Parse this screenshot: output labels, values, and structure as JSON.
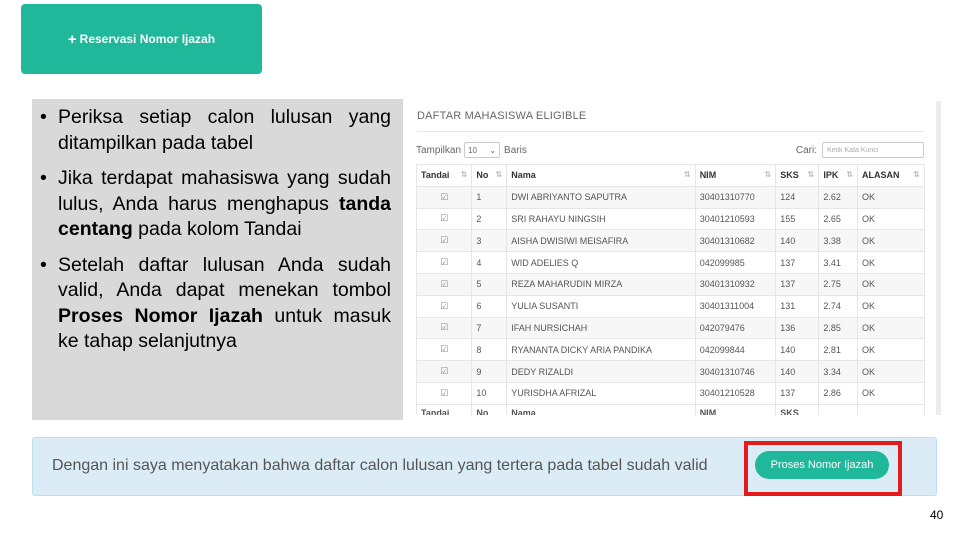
{
  "reserve_button": {
    "icon": "plus-icon",
    "label": "Reservasi Nomor Ijazah"
  },
  "notes": [
    {
      "parts": [
        {
          "text": "Periksa setiap calon lulusan yang ditampilkan pada tabel",
          "bold": false
        }
      ]
    },
    {
      "parts": [
        {
          "text": "Jika terdapat mahasiswa yang sudah lulus, Anda harus menghapus ",
          "bold": false
        },
        {
          "text": "tanda centang",
          "bold": true
        },
        {
          "text": " pada kolom Tandai",
          "bold": false
        }
      ]
    },
    {
      "parts": [
        {
          "text": "Setelah daftar lulusan Anda sudah valid, Anda dapat menekan tombol ",
          "bold": false
        },
        {
          "text": "Proses Nomor Ijazah",
          "bold": true
        },
        {
          "text": " untuk masuk ke tahap selanjutnya",
          "bold": false
        }
      ]
    }
  ],
  "panel": {
    "title": "DAFTAR MAHASISWA ELIGIBLE",
    "show_label": "Tampilkan",
    "page_size": "10",
    "rows_label": "Baris",
    "search_label": "Cari:",
    "search_placeholder": "Ketik Kata Kunci"
  },
  "table": {
    "headers": [
      "Tandai",
      "No",
      "Nama",
      "NIM",
      "SKS",
      "IPK",
      "ALASAN"
    ],
    "footer_headers": [
      "Tandai",
      "No",
      "Nama",
      "NIM",
      "SKS",
      "",
      ""
    ],
    "rows": [
      [
        "☑",
        "1",
        "DWI ABRIYANTO SAPUTRA",
        "30401310770",
        "124",
        "2.62",
        "OK"
      ],
      [
        "☑",
        "2",
        "SRI RAHAYU NINGSIH",
        "30401210593",
        "155",
        "2.65",
        "OK"
      ],
      [
        "☑",
        "3",
        "AISHA DWISIWI MEISAFIRA",
        "30401310682",
        "140",
        "3.38",
        "OK"
      ],
      [
        "☑",
        "4",
        "WID ADELIES Q",
        "042099985",
        "137",
        "3.41",
        "OK"
      ],
      [
        "☑",
        "5",
        "REZA MAHARUDIN MIRZA",
        "30401310932",
        "137",
        "2.75",
        "OK"
      ],
      [
        "☑",
        "6",
        "YULIA SUSANTI",
        "30401311004",
        "131",
        "2.74",
        "OK"
      ],
      [
        "☑",
        "7",
        "IFAH NURSICHAH",
        "042079476",
        "136",
        "2.85",
        "OK"
      ],
      [
        "☑",
        "8",
        "RYANANTA DICKY ARIA PANDIKA",
        "042099844",
        "140",
        "2.81",
        "OK"
      ],
      [
        "☑",
        "9",
        "DEDY RIZALDI",
        "30401310746",
        "140",
        "3.34",
        "OK"
      ],
      [
        "☑",
        "10",
        "YURISDHA AFRIZAL",
        "30401210528",
        "137",
        "2.86",
        "OK"
      ]
    ]
  },
  "confirm": {
    "text": "Dengan ini saya menyatakan bahwa daftar calon lulusan yang tertera pada tabel sudah valid",
    "button_label": "Proses Nomor Ijazah",
    "highlight_color": "#e31b1b"
  },
  "colors": {
    "accent": "#1fb89a"
  },
  "page_number": "40"
}
